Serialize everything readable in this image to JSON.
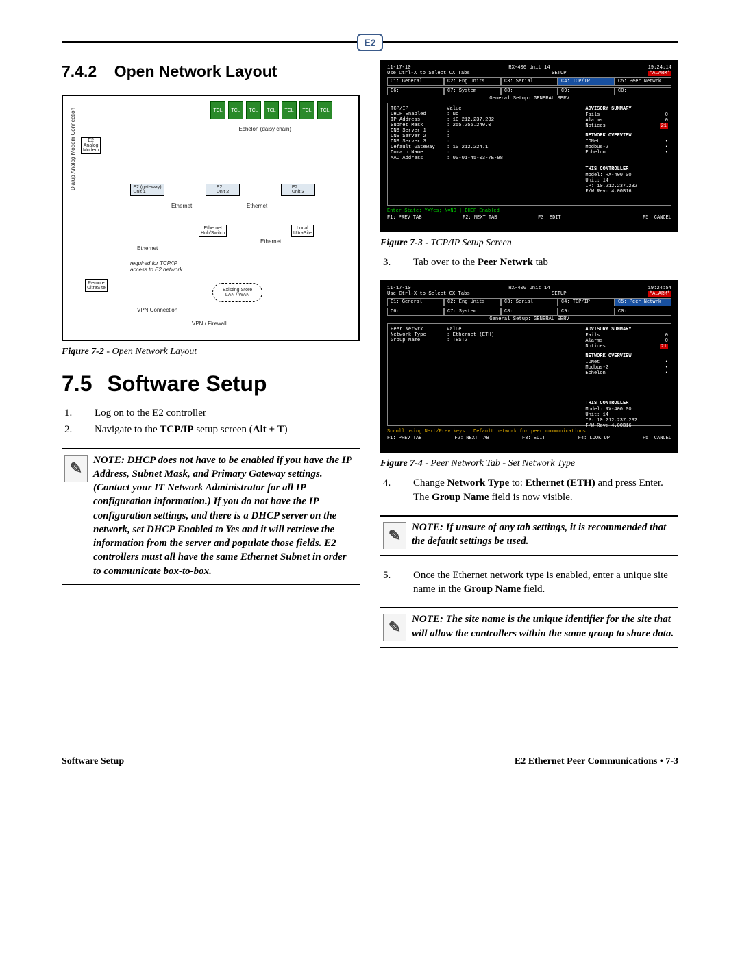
{
  "logo_text": "E2",
  "section_742": {
    "num": "7.4.2",
    "title": "Open Network Layout"
  },
  "figure72": {
    "caption_label": "Figure 7-2",
    "caption_text": " - Open Network Layout",
    "diagram": {
      "tcl": "TCL",
      "echelon": "Echelon (daisy chain)",
      "e2_analog_modem": "E2\nAnalog\nModem",
      "e2_gateway": "E2 (gateway)\nUnit 1",
      "e2_unit2": "E2\nUnit 2",
      "e2_unit3": "E2\nUnit 3",
      "ethernet": "Ethernet",
      "hub": "Ethernet\nHub/Switch",
      "local_us": "Local\nUltraSite",
      "dialup_label": "Dialup Analog Modem Connection",
      "tcpip_req": "required for TCP/IP\naccess to E2 network",
      "remote_us": "Remote\nUltraSite",
      "vpn_conn": "VPN Connection",
      "lan": "Existing Store\nLAN / WAN",
      "vpn_fw": "VPN / Firewall"
    }
  },
  "section_75": {
    "num": "7.5",
    "title": "Software Setup"
  },
  "list_left": [
    {
      "n": "1.",
      "text": "Log on to the E2 controller"
    },
    {
      "n": "2.",
      "pre": "Navigate to the ",
      "b1": "TCP/IP",
      "mid": " setup screen (",
      "b2": "Alt + T",
      "post": ")"
    }
  ],
  "note1": "NOTE: DHCP does not have to be enabled if you have the IP Address, Subnet Mask, and Primary Gateway settings. (Contact your IT Network Administrator for all IP configuration information.) If you do not have the IP configuration settings, and there is a DHCP server on the network, set DHCP Enabled to Yes and it will retrieve the information from the server and populate those fields. E2 controllers must all have the same Ethernet Subnet in order to communicate box-to-box.",
  "figure73": {
    "caption_label": "Figure 7-3",
    "caption_text": " - TCP/IP Setup Screen",
    "screen": {
      "date": "11-17-10",
      "model": "RX-400 Unit 14",
      "time": "19:24:14",
      "alarm": "*ALARM*",
      "tab_instr": "Use Ctrl-X to Select CX Tabs",
      "setup": "SETUP",
      "tabs1": [
        "C1: General",
        "C2: Eng Units",
        "C3: Serial",
        "C4: TCP/IP",
        "C5: Peer Netwrk"
      ],
      "tabs2": [
        "C6:",
        "C7: System",
        "C8:",
        "C9:",
        "C0:"
      ],
      "title": "General Setup: GENERAL SERV",
      "rows": [
        [
          "TCP/IP",
          "Value"
        ],
        [
          "DHCP Enabled",
          ": No"
        ],
        [
          "IP Address",
          ": 10.212.237.232"
        ],
        [
          "Subnet Mask",
          ": 255.255.240.0"
        ],
        [
          "DNS Server 1",
          ":"
        ],
        [
          "DNS Server 2",
          ":"
        ],
        [
          "DNS Server 3",
          ":"
        ],
        [
          "Default Gateway",
          ": 10.212.224.1"
        ],
        [
          "Domain Name",
          ":"
        ],
        [
          "MAC Address",
          ": 00-01-45-03-7E-98"
        ]
      ],
      "side_summary_hdr": "ADVISORY SUMMARY",
      "side_summary": [
        [
          "Fails",
          "0"
        ],
        [
          "Alarms",
          "0"
        ],
        [
          "Notices",
          "21"
        ]
      ],
      "side_net_hdr": "NETWORK OVERVIEW",
      "side_net": [
        [
          "IONet",
          "•"
        ],
        [
          "Modbus-2",
          "•"
        ],
        [
          "Echelon",
          "•"
        ]
      ],
      "side_ctrl_hdr": "THIS CONTROLLER",
      "side_ctrl": [
        "Model: RX-400  00",
        "Unit: 14",
        "IP: 10.212.237.232",
        "F/W Rev: 4.00B16"
      ],
      "foot_state": "Enter State:  Y=Yes;  N=NO  |  DHCP Enabled",
      "fkeys": [
        "F1: PREV TAB",
        "F2: NEXT TAB",
        "F3: EDIT",
        "",
        "F5: CANCEL"
      ]
    }
  },
  "list_right_3": {
    "n": "3.",
    "pre": "Tab over to the ",
    "b1": "Peer Netwrk",
    "post": " tab"
  },
  "figure74": {
    "caption_label": "Figure 7-4",
    "caption_text": " - Peer Network Tab - Set Network Type",
    "screen": {
      "date": "11-17-10",
      "model": "RX-400 Unit 14",
      "time": "19:24:54",
      "alarm": "*ALARM*",
      "tab_instr": "Use Ctrl-X to Select CX Tabs",
      "setup": "SETUP",
      "tabs1": [
        "C1: General",
        "C2: Eng Units",
        "C3: Serial",
        "C4: TCP/IP",
        "C5: Peer Netwrk"
      ],
      "tabs2": [
        "C6:",
        "C7: System",
        "C8:",
        "C9:",
        "C0:"
      ],
      "title": "General Setup: GENERAL SERV",
      "rows": [
        [
          "Peer Netwrk",
          "Value"
        ],
        [
          "Network Type",
          ": Ethernet (ETH)"
        ],
        [
          "Group Name",
          ": TEST2"
        ]
      ],
      "side_summary_hdr": "ADVISORY SUMMARY",
      "side_summary": [
        [
          "Fails",
          "0"
        ],
        [
          "Alarms",
          "0"
        ],
        [
          "Notices",
          "21"
        ]
      ],
      "side_net_hdr": "NETWORK OVERVIEW",
      "side_net": [
        [
          "IONet",
          "•"
        ],
        [
          "Modbus-2",
          "•"
        ],
        [
          "Echelon",
          "•"
        ]
      ],
      "side_ctrl_hdr": "THIS CONTROLLER",
      "side_ctrl": [
        "Model: RX-400  00",
        "Unit: 14",
        "IP: 10.212.237.232",
        "F/W Rev: 4.00B16"
      ],
      "foot_state": "Scroll using Next/Prev keys  |  Default network for peer communications",
      "fkeys": [
        "F1: PREV TAB",
        "F2: NEXT TAB",
        "F3: EDIT",
        "F4: LOOK UP",
        "F5: CANCEL"
      ]
    }
  },
  "list_right_4": {
    "n": "4.",
    "pre": "Change ",
    "b1": "Network Type",
    "mid1": " to: ",
    "b2": "Ethernet (ETH)",
    "mid2": " and press Enter. The ",
    "b3": "Group Name",
    "post": " field is now visible."
  },
  "note2": "NOTE: If unsure of any tab settings, it is recommended that the default settings be used.",
  "list_right_5": {
    "n": "5.",
    "pre": "Once the Ethernet network type is enabled, enter a unique site name in the ",
    "b1": "Group Name",
    "post": " field."
  },
  "note3": "NOTE: The site name is the unique identifier for the site that will allow the controllers within the same group to share data.",
  "footer_left": "Software Setup",
  "footer_right": "E2 Ethernet Peer Communications • 7-3"
}
